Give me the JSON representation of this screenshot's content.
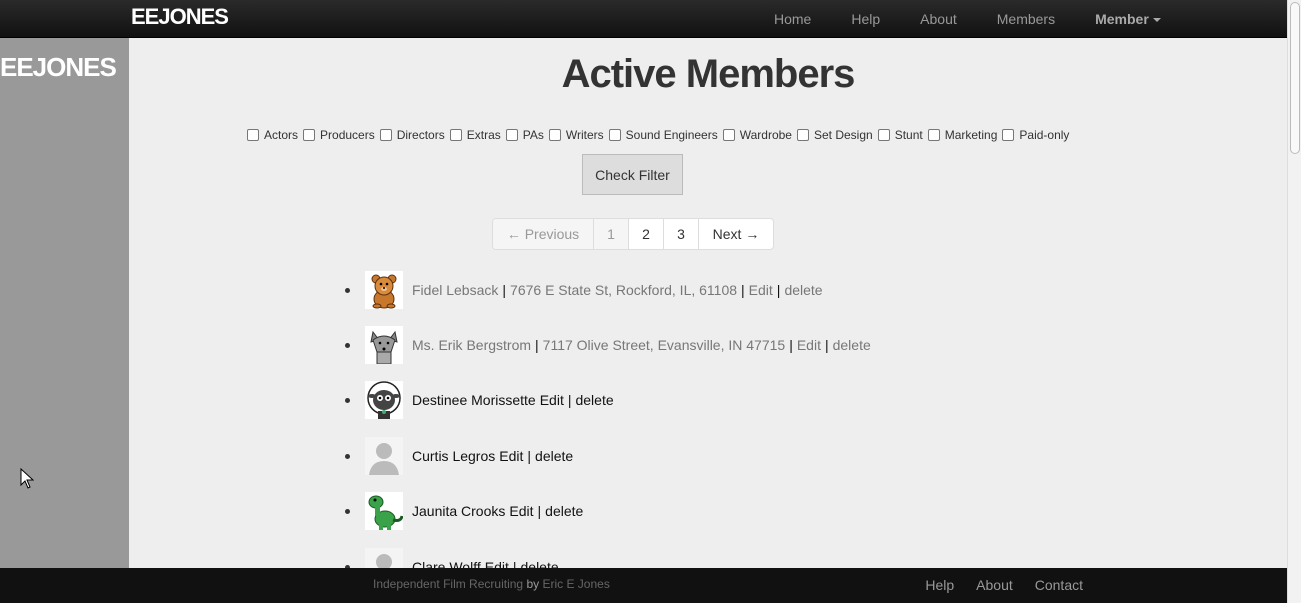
{
  "navbar": {
    "brand": "EEJONES",
    "links": [
      "Home",
      "Help",
      "About",
      "Members"
    ],
    "member_menu": "Member"
  },
  "sidebar": {
    "title": "EEJONES"
  },
  "main": {
    "title": "Active Members",
    "filters": [
      "Actors",
      "Producers",
      "Directors",
      "Extras",
      "PAs",
      "Writers",
      "Sound Engineers",
      "Wardrobe",
      "Set Design",
      "Stunt",
      "Marketing",
      "Paid-only"
    ],
    "check_filter": "Check Filter",
    "pagination": {
      "previous": "← Previous",
      "pages": [
        "1",
        "2",
        "3"
      ],
      "next": "Next →"
    },
    "members": [
      {
        "name": "Fidel Lebsack",
        "address": "7676 E State St, Rockford, IL, 61108",
        "edit": "Edit",
        "delete": "delete",
        "avatar": "bear-icon"
      },
      {
        "name": "Ms. Erik Bergstrom",
        "address": "7117 Olive Street, Evansville, IN 47715",
        "edit": "Edit",
        "delete": "delete",
        "avatar": "wolf-icon"
      },
      {
        "name": "Destinee Morissette",
        "edit": "Edit",
        "delete": "delete",
        "avatar": "sheep-icon"
      },
      {
        "name": "Curtis Legros",
        "edit": "Edit",
        "delete": "delete",
        "avatar": "default-avatar-icon"
      },
      {
        "name": "Jaunita Crooks",
        "edit": "Edit",
        "delete": "delete",
        "avatar": "dinosaur-icon"
      },
      {
        "name": "Clare Wolff",
        "edit": "Edit",
        "delete": "delete",
        "avatar": "default-avatar-icon"
      }
    ]
  },
  "footer": {
    "text_prefix": "Independent Film Recruiting",
    "by": "by",
    "author": "Eric E Jones",
    "links": [
      "Help",
      "About",
      "Contact"
    ]
  },
  "separator": "|",
  "colors": {
    "navbar": "#111111",
    "sidebar": "#999999",
    "background": "#eeeeee"
  }
}
